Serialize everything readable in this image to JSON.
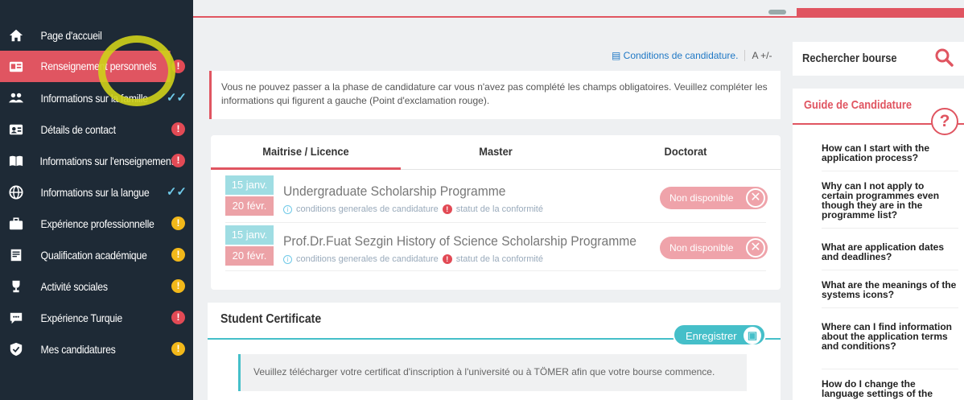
{
  "sidebar": {
    "items": [
      {
        "label": "Page d'accueil",
        "icon": "home-icon",
        "badge": ""
      },
      {
        "label": "Renseignement personnels",
        "icon": "id-card-icon",
        "badge": "red"
      },
      {
        "label": "Informations sur la famille",
        "icon": "family-icon",
        "badge": "check"
      },
      {
        "label": "Détails de contact",
        "icon": "contact-card-icon",
        "badge": "red"
      },
      {
        "label": "Informations sur l'enseignement",
        "icon": "book-icon",
        "badge": "red"
      },
      {
        "label": "Informations sur la langue",
        "icon": "globe-icon",
        "badge": "check"
      },
      {
        "label": "Expérience professionnelle",
        "icon": "briefcase-icon",
        "badge": "yellow"
      },
      {
        "label": "Qualification académique",
        "icon": "certificate-icon",
        "badge": "yellow"
      },
      {
        "label": "Activité sociales",
        "icon": "trophy-icon",
        "badge": "yellow"
      },
      {
        "label": "Expérience Turquie",
        "icon": "chat-icon",
        "badge": "red"
      },
      {
        "label": "Mes candidatures",
        "icon": "shield-check-icon",
        "badge": "yellow"
      }
    ],
    "active_index": 1,
    "badge_mark": "!",
    "check_mark": "✓✓"
  },
  "links": {
    "conditions": "Conditions de candidature.",
    "font_size": "A +/-"
  },
  "warning": {
    "text": "Vous ne pouvez passer a la phase de candidature car vous n'avez pas complété les champs obligatoires. Veuillez compléter les informations qui figurent a gauche (Point d'exclamation rouge)."
  },
  "tabs": [
    "Maitrise / Licence",
    "Master",
    "Doctorat"
  ],
  "programmes": [
    {
      "start": "15 janv.",
      "end": "20 févr.",
      "title": "Undergraduate Scholarship Programme",
      "conditions": "conditions generales de candidature",
      "status": "statut de la conformité",
      "availability": "Non disponible"
    },
    {
      "start": "15 janv.",
      "end": "20 févr.",
      "title": "Prof.Dr.Fuat Sezgin History of Science Scholarship Programme",
      "conditions": "conditions generales de candidature",
      "status": "statut de la conformité",
      "availability": "Non disponible"
    }
  ],
  "certificate": {
    "title": "Student Certificate",
    "save_label": "Enregistrer",
    "message": "Veuillez télécharger votre certificat d'inscription à l'université ou à TÖMER afin que votre bourse commence."
  },
  "right_panel": {
    "search_label": "Rechercher bourse",
    "guide_title": "Guide de Candidature",
    "faqs": [
      "How can I start with the application process?",
      "Why can I not apply to certain programmes even though they are in the programme list?",
      "What are application dates and deadlines?",
      "What are the meanings of the systems icons?",
      "Where can I find information about the application terms and conditions?",
      "How do I change the language settings of the"
    ]
  },
  "colors": {
    "sidebar": "#1e2a36",
    "accent": "#e05561",
    "teal": "#45bfc9",
    "warning_yellow": "#f2b81a"
  }
}
